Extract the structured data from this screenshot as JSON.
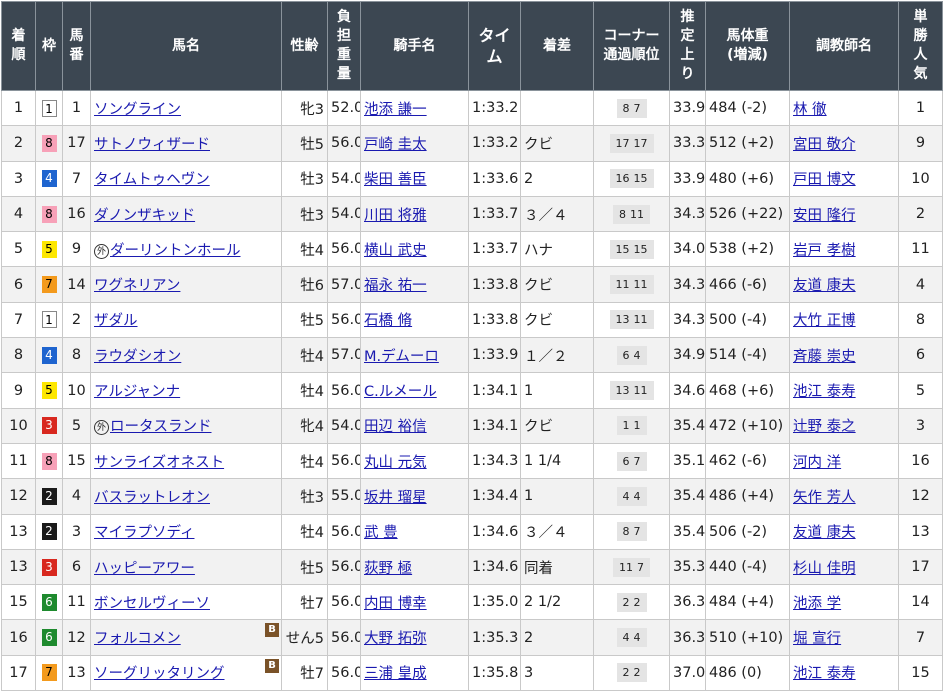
{
  "headers": {
    "chakujun": [
      "着",
      "順"
    ],
    "waku": "枠",
    "umaban": [
      "馬",
      "番"
    ],
    "bamei": "馬名",
    "seirei": "性齢",
    "kinryo": [
      "負",
      "担",
      "重",
      "量"
    ],
    "kishu": "騎手名",
    "time": [
      "タイ",
      "ム"
    ],
    "chakusa": "着差",
    "corner": [
      "コーナー",
      "通過順位"
    ],
    "agari": [
      "推",
      "定",
      "上",
      "り"
    ],
    "bataiju": [
      "馬体重",
      "(増減)"
    ],
    "chokyoshi": "調教師名",
    "ninki": [
      "単",
      "勝",
      "人",
      "気"
    ]
  },
  "rows": [
    {
      "rank": "1",
      "waku": "1",
      "umaban": "1",
      "mark": "",
      "name": "ソングライン",
      "blinker": false,
      "sex_age": "牝3",
      "weight": "52.0",
      "jockey": "池添 謙一",
      "time": "1:33.2",
      "margin": "",
      "corner": [
        "8",
        "7"
      ],
      "agari": "33.9",
      "body_weight": "484 (-2)",
      "trainer": "林 徹",
      "popularity": "1"
    },
    {
      "rank": "2",
      "waku": "8",
      "umaban": "17",
      "mark": "",
      "name": "サトノウィザード",
      "blinker": false,
      "sex_age": "牡5",
      "weight": "56.0",
      "jockey": "戸崎 圭太",
      "time": "1:33.2",
      "margin": "クビ",
      "corner": [
        "17",
        "17"
      ],
      "agari": "33.3",
      "body_weight": "512 (+2)",
      "trainer": "宮田 敬介",
      "popularity": "9"
    },
    {
      "rank": "3",
      "waku": "4",
      "umaban": "7",
      "mark": "",
      "name": "タイムトゥヘヴン",
      "blinker": false,
      "sex_age": "牡3",
      "weight": "54.0",
      "jockey": "柴田 善臣",
      "time": "1:33.6",
      "margin": "2",
      "corner": [
        "16",
        "15"
      ],
      "agari": "33.9",
      "body_weight": "480 (+6)",
      "trainer": "戸田 博文",
      "popularity": "10"
    },
    {
      "rank": "4",
      "waku": "8",
      "umaban": "16",
      "mark": "",
      "name": "ダノンザキッド",
      "blinker": false,
      "sex_age": "牡3",
      "weight": "54.0",
      "jockey": "川田 将雅",
      "time": "1:33.7",
      "margin": "３／４",
      "corner": [
        "8",
        "11"
      ],
      "agari": "34.3",
      "body_weight": "526 (+22)",
      "trainer": "安田 隆行",
      "popularity": "2"
    },
    {
      "rank": "5",
      "waku": "5",
      "umaban": "9",
      "mark": "外",
      "name": "ダーリントンホール",
      "blinker": false,
      "sex_age": "牡4",
      "weight": "56.0",
      "jockey": "横山 武史",
      "time": "1:33.7",
      "margin": "ハナ",
      "corner": [
        "15",
        "15"
      ],
      "agari": "34.0",
      "body_weight": "538 (+2)",
      "trainer": "岩戸 孝樹",
      "popularity": "11"
    },
    {
      "rank": "6",
      "waku": "7",
      "umaban": "14",
      "mark": "",
      "name": "ワグネリアン",
      "blinker": false,
      "sex_age": "牡6",
      "weight": "57.0",
      "jockey": "福永 祐一",
      "time": "1:33.8",
      "margin": "クビ",
      "corner": [
        "11",
        "11"
      ],
      "agari": "34.3",
      "body_weight": "466 (-6)",
      "trainer": "友道 康夫",
      "popularity": "4"
    },
    {
      "rank": "7",
      "waku": "1",
      "umaban": "2",
      "mark": "",
      "name": "ザダル",
      "blinker": false,
      "sex_age": "牡5",
      "weight": "56.0",
      "jockey": "石橋 脩",
      "time": "1:33.8",
      "margin": "クビ",
      "corner": [
        "13",
        "11"
      ],
      "agari": "34.3",
      "body_weight": "500 (-4)",
      "trainer": "大竹 正博",
      "popularity": "8"
    },
    {
      "rank": "8",
      "waku": "4",
      "umaban": "8",
      "mark": "",
      "name": "ラウダシオン",
      "blinker": false,
      "sex_age": "牡4",
      "weight": "57.0",
      "jockey": "M.デムーロ",
      "time": "1:33.9",
      "margin": "１／２",
      "corner": [
        "6",
        "4"
      ],
      "agari": "34.9",
      "body_weight": "514 (-4)",
      "trainer": "斉藤 崇史",
      "popularity": "6"
    },
    {
      "rank": "9",
      "waku": "5",
      "umaban": "10",
      "mark": "",
      "name": "アルジャンナ",
      "blinker": false,
      "sex_age": "牡4",
      "weight": "56.0",
      "jockey": "C.ルメール",
      "time": "1:34.1",
      "margin": "1",
      "corner": [
        "13",
        "11"
      ],
      "agari": "34.6",
      "body_weight": "468 (+6)",
      "trainer": "池江 泰寿",
      "popularity": "5"
    },
    {
      "rank": "10",
      "waku": "3",
      "umaban": "5",
      "mark": "外",
      "name": "ロータスランド",
      "blinker": false,
      "sex_age": "牝4",
      "weight": "54.0",
      "jockey": "田辺 裕信",
      "time": "1:34.1",
      "margin": "クビ",
      "corner": [
        "1",
        "1"
      ],
      "agari": "35.4",
      "body_weight": "472 (+10)",
      "trainer": "辻野 泰之",
      "popularity": "3"
    },
    {
      "rank": "11",
      "waku": "8",
      "umaban": "15",
      "mark": "",
      "name": "サンライズオネスト",
      "blinker": false,
      "sex_age": "牡4",
      "weight": "56.0",
      "jockey": "丸山 元気",
      "time": "1:34.3",
      "margin": "1 1/4",
      "corner": [
        "6",
        "7"
      ],
      "agari": "35.1",
      "body_weight": "462 (-6)",
      "trainer": "河内 洋",
      "popularity": "16"
    },
    {
      "rank": "12",
      "waku": "2",
      "umaban": "4",
      "mark": "",
      "name": "バスラットレオン",
      "blinker": false,
      "sex_age": "牡3",
      "weight": "55.0",
      "jockey": "坂井 瑠星",
      "time": "1:34.4",
      "margin": "1",
      "corner": [
        "4",
        "4"
      ],
      "agari": "35.4",
      "body_weight": "486 (+4)",
      "trainer": "矢作 芳人",
      "popularity": "12"
    },
    {
      "rank": "13",
      "waku": "2",
      "umaban": "3",
      "mark": "",
      "name": "マイラプソディ",
      "blinker": false,
      "sex_age": "牡4",
      "weight": "56.0",
      "jockey": "武 豊",
      "time": "1:34.6",
      "margin": "３／４",
      "corner": [
        "8",
        "7"
      ],
      "agari": "35.4",
      "body_weight": "506 (-2)",
      "trainer": "友道 康夫",
      "popularity": "13"
    },
    {
      "rank": "13",
      "waku": "3",
      "umaban": "6",
      "mark": "",
      "name": "ハッピーアワー",
      "blinker": false,
      "sex_age": "牡5",
      "weight": "56.0",
      "jockey": "荻野 極",
      "time": "1:34.6",
      "margin": "同着",
      "corner": [
        "11",
        "7"
      ],
      "agari": "35.3",
      "body_weight": "440 (-4)",
      "trainer": "杉山 佳明",
      "popularity": "17"
    },
    {
      "rank": "15",
      "waku": "6",
      "umaban": "11",
      "mark": "",
      "name": "ボンセルヴィーソ",
      "blinker": false,
      "sex_age": "牡7",
      "weight": "56.0",
      "jockey": "内田 博幸",
      "time": "1:35.0",
      "margin": "2 1/2",
      "corner": [
        "2",
        "2"
      ],
      "agari": "36.3",
      "body_weight": "484 (+4)",
      "trainer": "池添 学",
      "popularity": "14"
    },
    {
      "rank": "16",
      "waku": "6",
      "umaban": "12",
      "mark": "",
      "name": "フォルコメン",
      "blinker": true,
      "sex_age": "せん5",
      "weight": "56.0",
      "jockey": "大野 拓弥",
      "time": "1:35.3",
      "margin": "2",
      "corner": [
        "4",
        "4"
      ],
      "agari": "36.3",
      "body_weight": "510 (+10)",
      "trainer": "堀 宣行",
      "popularity": "7"
    },
    {
      "rank": "17",
      "waku": "7",
      "umaban": "13",
      "mark": "",
      "name": "ソーグリッタリング",
      "blinker": true,
      "sex_age": "牡7",
      "weight": "56.0",
      "jockey": "三浦 皇成",
      "time": "1:35.8",
      "margin": "3",
      "corner": [
        "2",
        "2"
      ],
      "agari": "37.0",
      "body_weight": "486 (0)",
      "trainer": "池江 泰寿",
      "popularity": "15"
    }
  ],
  "blinker_label": "B",
  "colors": {
    "header_bg": "#3c4752",
    "link": "#1a1ab0",
    "waku": {
      "1": "#ffffff",
      "2": "#1a1a1a",
      "3": "#d8281f",
      "4": "#1e64cf",
      "5": "#fde700",
      "6": "#1e8a2e",
      "7": "#f39a1d",
      "8": "#f7a1b8"
    }
  }
}
